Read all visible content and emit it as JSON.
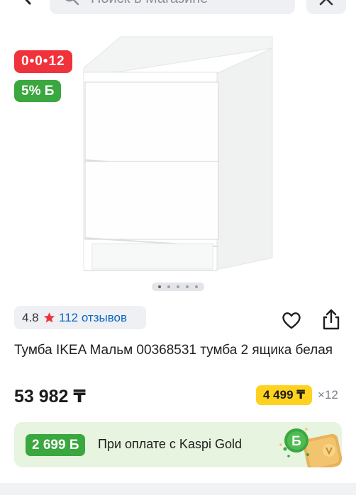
{
  "search": {
    "placeholder": "Поиск в Магазине"
  },
  "badges": {
    "installment": "0•0•12",
    "bonus": "5% Б"
  },
  "gallery": {
    "dots_count": 5,
    "active_index": 0
  },
  "rating": {
    "value": "4.8",
    "reviews_label": "112 отзывов"
  },
  "product": {
    "title": "Тумба IKEA Мальм 00368531 тумба 2 ящика белая",
    "price": "53 982 ₸",
    "monthly_payment": "4 499 ₸",
    "months": "×12"
  },
  "promo": {
    "bonus_amount": "2 699 Б",
    "text": "При оплате с Kaspi Gold"
  },
  "colors": {
    "installment_badge": "#f0323a",
    "bonus_badge": "#3aa73f",
    "monthly_badge": "#ffd21f",
    "link": "#0b66c2",
    "star": "#f0323a",
    "promo_bg": "#e6f4e0"
  },
  "icons": [
    "chevron-left-icon",
    "search-icon",
    "close-icon",
    "star-icon",
    "heart-icon",
    "share-icon"
  ]
}
